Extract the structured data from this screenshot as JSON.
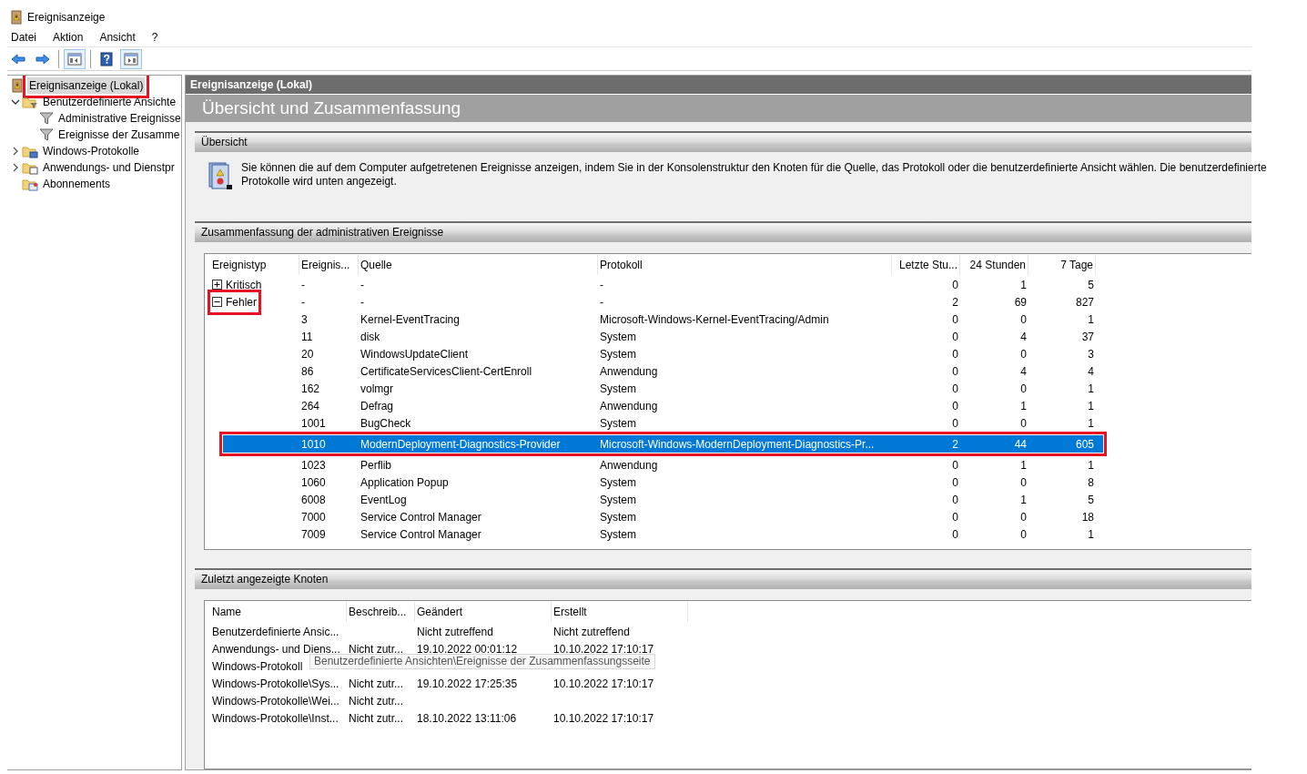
{
  "window": {
    "title": "Ereignisanzeige"
  },
  "menu": [
    "Datei",
    "Aktion",
    "Ansicht",
    "?"
  ],
  "toolbar": [
    {
      "kind": "back",
      "pressed": false
    },
    {
      "kind": "forward",
      "pressed": false
    },
    {
      "kind": "separator"
    },
    {
      "kind": "console_tree",
      "pressed": true
    },
    {
      "kind": "separator"
    },
    {
      "kind": "help",
      "pressed": false
    },
    {
      "kind": "action_pane",
      "pressed": true
    }
  ],
  "tree": {
    "items": [
      {
        "label": "Ereignisanzeige (Lokal)",
        "kind": "viewer",
        "selected": true,
        "marked": true,
        "children": [
          {
            "label": "Benutzerdefinierte Ansichte",
            "kind": "custom_views",
            "selected": false,
            "marked": false,
            "expanded": true,
            "children": [
              {
                "label": "Administrative Ereignisse",
                "kind": "filter",
                "selected": false,
                "marked": false
              },
              {
                "label": "Ereignisse der Zusamme",
                "kind": "filter",
                "selected": false,
                "marked": false
              }
            ]
          },
          {
            "label": "Windows-Protokolle",
            "kind": "logs",
            "selected": false,
            "marked": false,
            "expanded": false
          },
          {
            "label": "Anwendungs- und Dienstpr",
            "kind": "services",
            "selected": false,
            "marked": false,
            "expanded": false
          },
          {
            "label": "Abonnements",
            "kind": "subscriptions",
            "selected": false,
            "marked": false
          }
        ]
      }
    ]
  },
  "content": {
    "header": "Ereignisanzeige (Lokal)",
    "title": "Übersicht und Zusammenfassung",
    "overview": {
      "header": "Übersicht",
      "lines": [
        "Sie können die auf dem Computer aufgetretenen Ereignisse anzeigen, indem Sie in der Konsolenstruktur den Knoten für die Quelle, das Protokoll oder die benutzerdefinierte Ansicht wählen. Die benutzerdefinierte",
        "Protokolle wird unten angezeigt."
      ]
    },
    "summary": {
      "header": "Zusammenfassung der administrativen Ereignisse",
      "columns": [
        "Ereignistyp",
        "Ereignis...",
        "Quelle",
        "Protokoll",
        "Letzte Stu...",
        "24 Stunden",
        "7 Tage"
      ],
      "rows": [
        {
          "type": "Kritisch",
          "expanded": false,
          "marked": false,
          "event_id": "-",
          "source": "-",
          "log": "-",
          "last_hour": "0",
          "last_24h": "1",
          "last_7d": "5"
        },
        {
          "type": "Fehler",
          "expanded": true,
          "marked": true,
          "event_id": "-",
          "source": "-",
          "log": "-",
          "last_hour": "2",
          "last_24h": "69",
          "last_7d": "827",
          "children": [
            {
              "event_id": "3",
              "source": "Kernel-EventTracing",
              "log": "Microsoft-Windows-Kernel-EventTracing/Admin",
              "last_hour": "0",
              "last_24h": "0",
              "last_7d": "1",
              "selected": false,
              "marked": false
            },
            {
              "event_id": "11",
              "source": "disk",
              "log": "System",
              "last_hour": "0",
              "last_24h": "4",
              "last_7d": "37",
              "selected": false,
              "marked": false
            },
            {
              "event_id": "20",
              "source": "WindowsUpdateClient",
              "log": "System",
              "last_hour": "0",
              "last_24h": "0",
              "last_7d": "3",
              "selected": false,
              "marked": false
            },
            {
              "event_id": "86",
              "source": "CertificateServicesClient-CertEnroll",
              "log": "Anwendung",
              "last_hour": "0",
              "last_24h": "4",
              "last_7d": "4",
              "selected": false,
              "marked": false
            },
            {
              "event_id": "162",
              "source": "volmgr",
              "log": "System",
              "last_hour": "0",
              "last_24h": "0",
              "last_7d": "1",
              "selected": false,
              "marked": false
            },
            {
              "event_id": "264",
              "source": "Defrag",
              "log": "Anwendung",
              "last_hour": "0",
              "last_24h": "1",
              "last_7d": "1",
              "selected": false,
              "marked": false
            },
            {
              "event_id": "1001",
              "source": "BugCheck",
              "log": "System",
              "last_hour": "0",
              "last_24h": "0",
              "last_7d": "1",
              "selected": false,
              "marked": false
            },
            {
              "event_id": "1010",
              "source": "ModernDeployment-Diagnostics-Provider",
              "log": "Microsoft-Windows-ModernDeployment-Diagnostics-Pr...",
              "last_hour": "2",
              "last_24h": "44",
              "last_7d": "605",
              "selected": true,
              "marked": true
            },
            {
              "event_id": "1023",
              "source": "Perflib",
              "log": "Anwendung",
              "last_hour": "0",
              "last_24h": "1",
              "last_7d": "1",
              "selected": false,
              "marked": false
            },
            {
              "event_id": "1060",
              "source": "Application Popup",
              "log": "System",
              "last_hour": "0",
              "last_24h": "0",
              "last_7d": "8",
              "selected": false,
              "marked": false
            },
            {
              "event_id": "6008",
              "source": "EventLog",
              "log": "System",
              "last_hour": "0",
              "last_24h": "1",
              "last_7d": "5",
              "selected": false,
              "marked": false
            },
            {
              "event_id": "7000",
              "source": "Service Control Manager",
              "log": "System",
              "last_hour": "0",
              "last_24h": "0",
              "last_7d": "18",
              "selected": false,
              "marked": false
            },
            {
              "event_id": "7009",
              "source": "Service Control Manager",
              "log": "System",
              "last_hour": "0",
              "last_24h": "0",
              "last_7d": "1",
              "selected": false,
              "marked": false
            }
          ]
        }
      ]
    },
    "recent": {
      "header": "Zuletzt angezeigte Knoten",
      "columns": [
        "Name",
        "Beschreib...",
        "Geändert",
        "Erstellt"
      ],
      "rows": [
        {
          "name": "Benutzerdefinierte Ansic...",
          "modified": "Nicht zutreffend",
          "created": "Nicht zutreffend"
        },
        {
          "name": "Anwendungs- und Diens...",
          "description": "Nicht zutr...",
          "modified": "19.10.2022 00:01:12",
          "created": "10.10.2022 17:10:17"
        },
        {
          "name": "Windows-Protokoll"
        },
        {
          "name": "Windows-Protokolle\\Sys...",
          "description": "Nicht zutr...",
          "modified": "19.10.2022 17:25:35",
          "created": "10.10.2022 17:10:17"
        },
        {
          "name": "Windows-Protokolle\\Wei...",
          "description": "Nicht zutr..."
        },
        {
          "name": "Windows-Protokolle\\Inst...",
          "description": "Nicht zutr...",
          "modified": "18.10.2022 13:11:06",
          "created": "10.10.2022 17:10:17"
        }
      ],
      "tooltip": "Benutzerdefinierte Ansichten\\Ereignisse der Zusammenfassungsseite"
    }
  }
}
